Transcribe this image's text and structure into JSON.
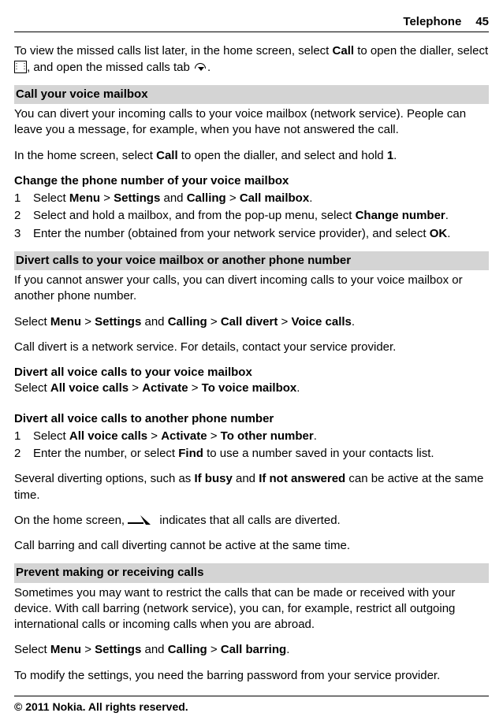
{
  "header": {
    "section": "Telephone",
    "page": "45"
  },
  "intro": {
    "t1": "To view the missed calls list later, in the home screen, select ",
    "call": "Call",
    "t2": " to open the dialler, select ",
    "t3": ", and open the missed calls tab ",
    "t4": "."
  },
  "voicemail": {
    "title": "Call your voice mailbox",
    "p1": "You can divert your incoming calls to your voice mailbox (network service). People can leave you a message, for example, when you have not answered the call.",
    "p2a": "In the home screen, select ",
    "call": "Call",
    "p2b": " to open the dialler, and select and hold ",
    "one": "1",
    "p2c": "."
  },
  "changeNum": {
    "title": "Change the phone number of your voice mailbox",
    "s1a": "Select ",
    "menu": "Menu",
    "gt1": " > ",
    "settings": "Settings",
    "and1": " and ",
    "calling": "Calling",
    "gt2": " > ",
    "mailbox": "Call mailbox",
    "s1b": ".",
    "s2a": "Select and hold a mailbox, and from the pop-up menu, select ",
    "chnum": "Change number",
    "s2b": ".",
    "s3a": "Enter the number (obtained from your network service provider), and select ",
    "ok": "OK",
    "s3b": "."
  },
  "divert": {
    "title": "Divert calls to your voice mailbox or another phone number",
    "p1": "If you cannot answer your calls, you can divert incoming calls to your voice mailbox or another phone number.",
    "p2a": "Select ",
    "menu": "Menu",
    "gt1": " > ",
    "settings": "Settings",
    "and1": " and ",
    "calling": "Calling",
    "gt2": " > ",
    "calldivert": "Call divert",
    "gt3": " > ",
    "voicecalls": "Voice calls",
    "p2b": ".",
    "p3": "Call divert is a network service. For details, contact your service provider."
  },
  "divertAllMailbox": {
    "title": "Divert all voice calls to your voice mailbox",
    "p1a": "Select ",
    "allvoice": "All voice calls",
    "gt1": " > ",
    "activate": "Activate",
    "gt2": " > ",
    "tovoicemail": "To voice mailbox",
    "p1b": "."
  },
  "divertAllOther": {
    "title": "Divert all voice calls to another phone number",
    "s1a": "Select ",
    "allvoice": "All voice calls",
    "gt1": " > ",
    "activate": "Activate",
    "gt2": " > ",
    "toother": "To other number",
    "s1b": ".",
    "s2a": "Enter the number, or select ",
    "find": "Find",
    "s2b": " to use a number saved in your contacts list."
  },
  "options": {
    "p1a": "Several diverting options, such as ",
    "ifbusy": "If busy",
    "p1b": " and ",
    "ifnotans": "If not answered",
    "p1c": " can be active at the same time.",
    "p2a": "On the home screen, ",
    "p2b": " indicates that all calls are diverted.",
    "p3": "Call barring and call diverting cannot be active at the same time."
  },
  "prevent": {
    "title": "Prevent making or receiving calls",
    "p1": "Sometimes you may want to restrict the calls that can be made or received with your device. With call barring (network service), you can, for example, restrict all outgoing international calls or incoming calls when you are abroad.",
    "p2a": "Select ",
    "menu": "Menu",
    "gt1": " > ",
    "settings": "Settings",
    "and1": " and ",
    "calling": "Calling",
    "gt2": " > ",
    "callbarring": "Call barring",
    "p2b": ".",
    "p3": "To modify the settings, you need the barring password from your service provider."
  },
  "footer": "© 2011 Nokia. All rights reserved."
}
